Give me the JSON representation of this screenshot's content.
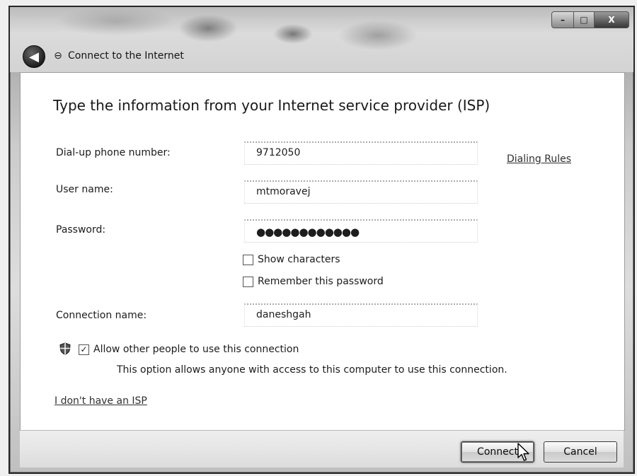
{
  "window": {
    "title": "Connect to the Internet",
    "controls": {
      "minimize": "–",
      "maximize": "□",
      "close": "X"
    }
  },
  "heading": "Type the information from your Internet service provider (ISP)",
  "form": {
    "phone": {
      "label": "Dial-up phone number:",
      "value": "9712050"
    },
    "dialing_rules": "Dialing Rules",
    "username": {
      "label": "User name:",
      "value": "mtmoravej"
    },
    "password": {
      "label": "Password:",
      "value": "●●●●●●●●●●●●"
    },
    "show_characters": {
      "label": "Show characters",
      "checked": false
    },
    "remember_password": {
      "label": "Remember this password",
      "checked": false
    },
    "connection_name": {
      "label": "Connection name:",
      "value": "daneshgah"
    },
    "allow_others": {
      "label": "Allow other people to use this connection",
      "checked": true,
      "check_mark": "✓",
      "note": "This option allows anyone with access to this computer to use this connection."
    },
    "no_isp_link": "I don't have an ISP"
  },
  "buttons": {
    "connect": "Connect",
    "cancel": "Cancel"
  },
  "icons": {
    "back": "back-arrow-icon",
    "connection": "network-connection-icon",
    "shield": "uac-shield-icon",
    "cursor": "mouse-pointer-icon"
  }
}
